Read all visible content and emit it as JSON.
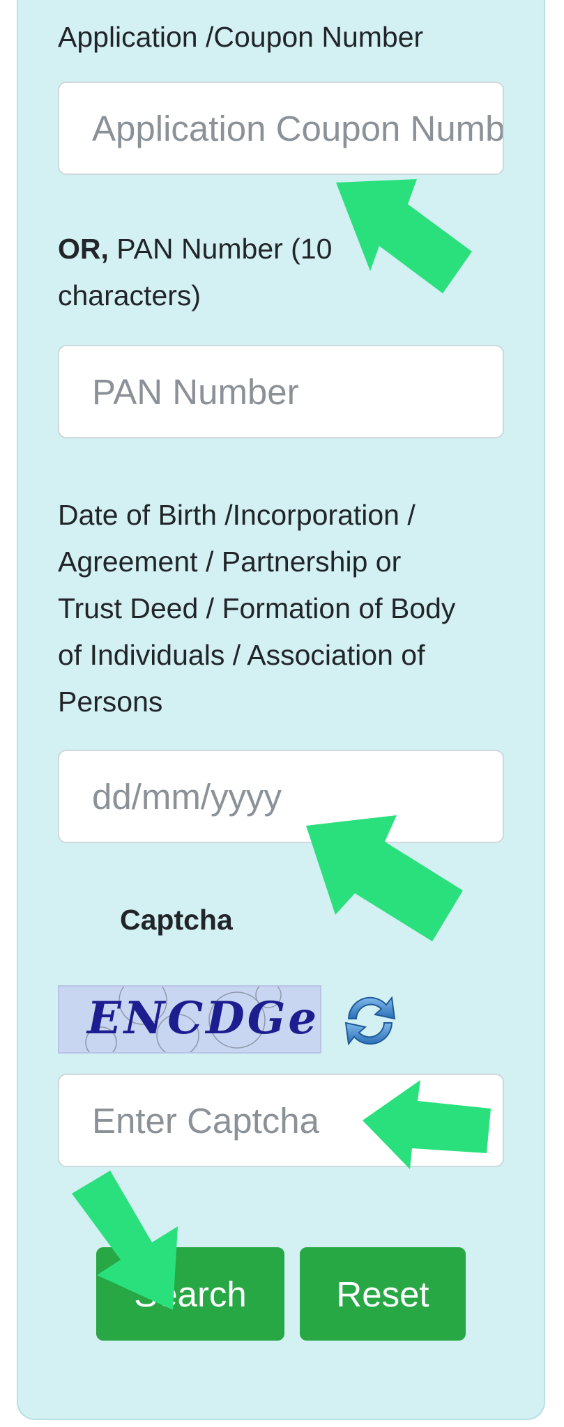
{
  "form": {
    "coupon": {
      "label": "Application /Coupon Number",
      "placeholder": "Application Coupon Number"
    },
    "pan": {
      "label_prefix": "OR,",
      "label_line1": " PAN Number (10",
      "label_line2": "characters)",
      "placeholder": "PAN Number"
    },
    "dob": {
      "label_lines": [
        "Date of Birth /Incorporation /",
        "Agreement / Partnership or",
        "Trust Deed / Formation of Body",
        "of Individuals / Association of",
        "Persons"
      ],
      "placeholder": "dd/mm/yyyy"
    },
    "captcha": {
      "heading": "Captcha",
      "image_text": "ENCDGe",
      "refresh_icon": "refresh-icon",
      "placeholder": "Enter Captcha"
    },
    "buttons": {
      "search": "Search",
      "reset": "Reset"
    }
  },
  "colors": {
    "panel_bg": "#d3f0f2",
    "button_green": "#28a745",
    "arrow_green": "#2ae07d",
    "captcha_text": "#1c1d8f"
  }
}
